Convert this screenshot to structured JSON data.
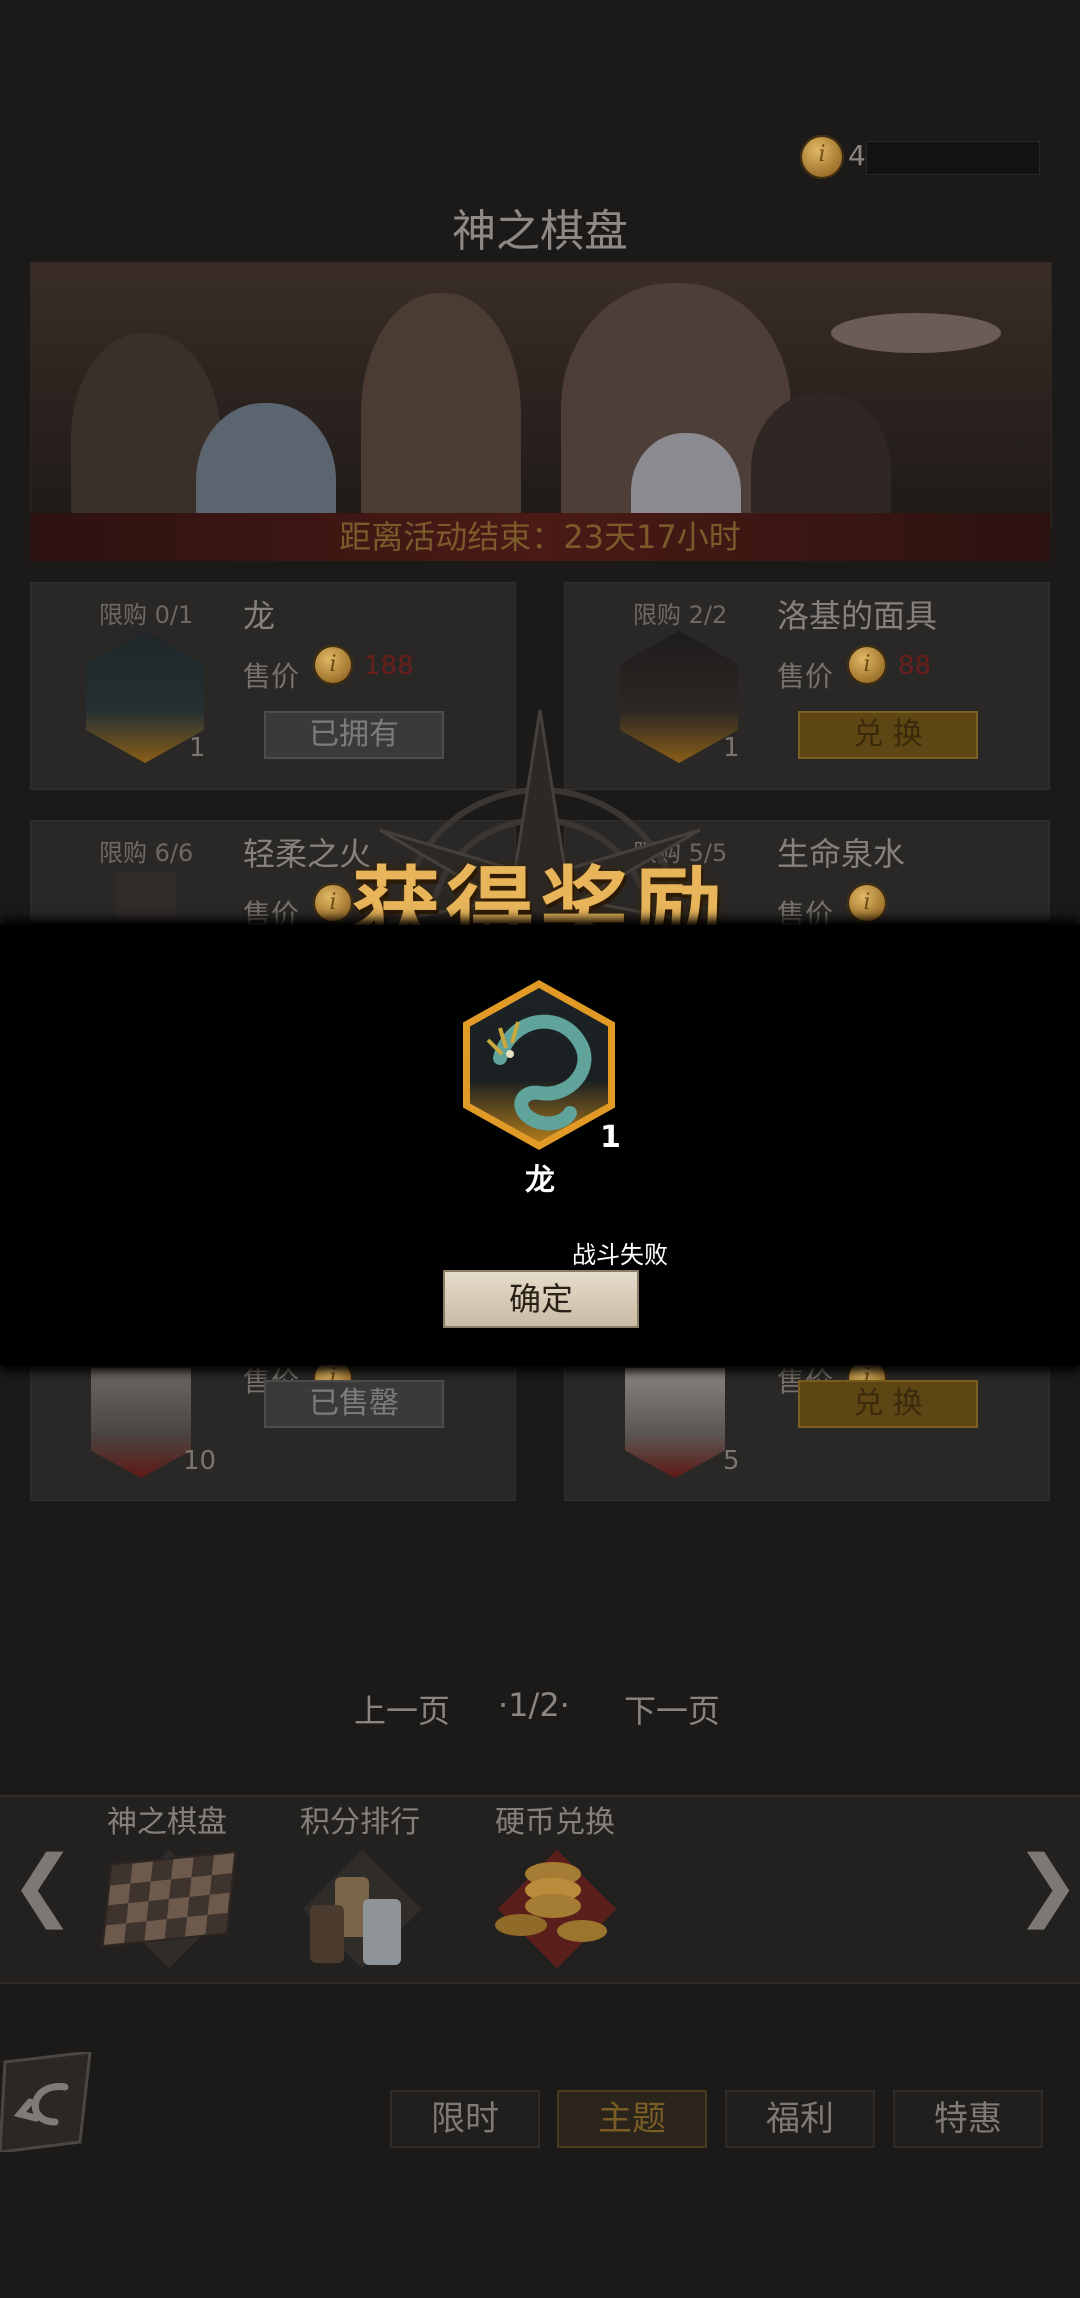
{
  "header": {
    "coin_count": "4",
    "title": "神之棋盘"
  },
  "banner": {
    "countdown": "距离活动结束：23天17小时"
  },
  "shop_items": [
    {
      "limit": "限购 0/1",
      "name": "龙",
      "price_label": "售价",
      "price": "188",
      "qty": "1",
      "button": "已拥有",
      "button_state": "owned"
    },
    {
      "limit": "限购 2/2",
      "name": "洛基的面具",
      "price_label": "售价",
      "price": "88",
      "qty": "1",
      "button": "兑 换",
      "button_state": "buy"
    },
    {
      "limit": "限购 6/6",
      "name": "轻柔之火",
      "price_label": "售价"
    },
    {
      "limit": "限购 5/5",
      "name": "生命泉水",
      "price_label": "售价"
    },
    {
      "price_label": "售价",
      "qty": "10",
      "button": "已售罄",
      "button_state": "sold"
    },
    {
      "price_label": "售价",
      "qty": "5",
      "button": "兑 换",
      "button_state": "buy"
    }
  ],
  "reward_popup": {
    "title": "获得奖励",
    "item_name": "龙",
    "item_qty": "1",
    "status": "战斗失败",
    "confirm": "确定"
  },
  "pagination": {
    "prev": "上一页",
    "page": "·1/2·",
    "next": "下一页"
  },
  "event_tabs": [
    {
      "label": "神之棋盘",
      "icon": "chessboard-icon"
    },
    {
      "label": "积分排行",
      "icon": "chess-pieces-icon"
    },
    {
      "label": "硬币兑换",
      "icon": "coins-icon"
    }
  ],
  "bottom_nav": [
    {
      "label": "限时",
      "active": false
    },
    {
      "label": "主题",
      "active": true
    },
    {
      "label": "福利",
      "active": false
    },
    {
      "label": "特惠",
      "active": false
    }
  ],
  "colors": {
    "accent_gold": "#e8b55b",
    "hex_gold": "#e09a25",
    "background": "#1b1a19"
  }
}
